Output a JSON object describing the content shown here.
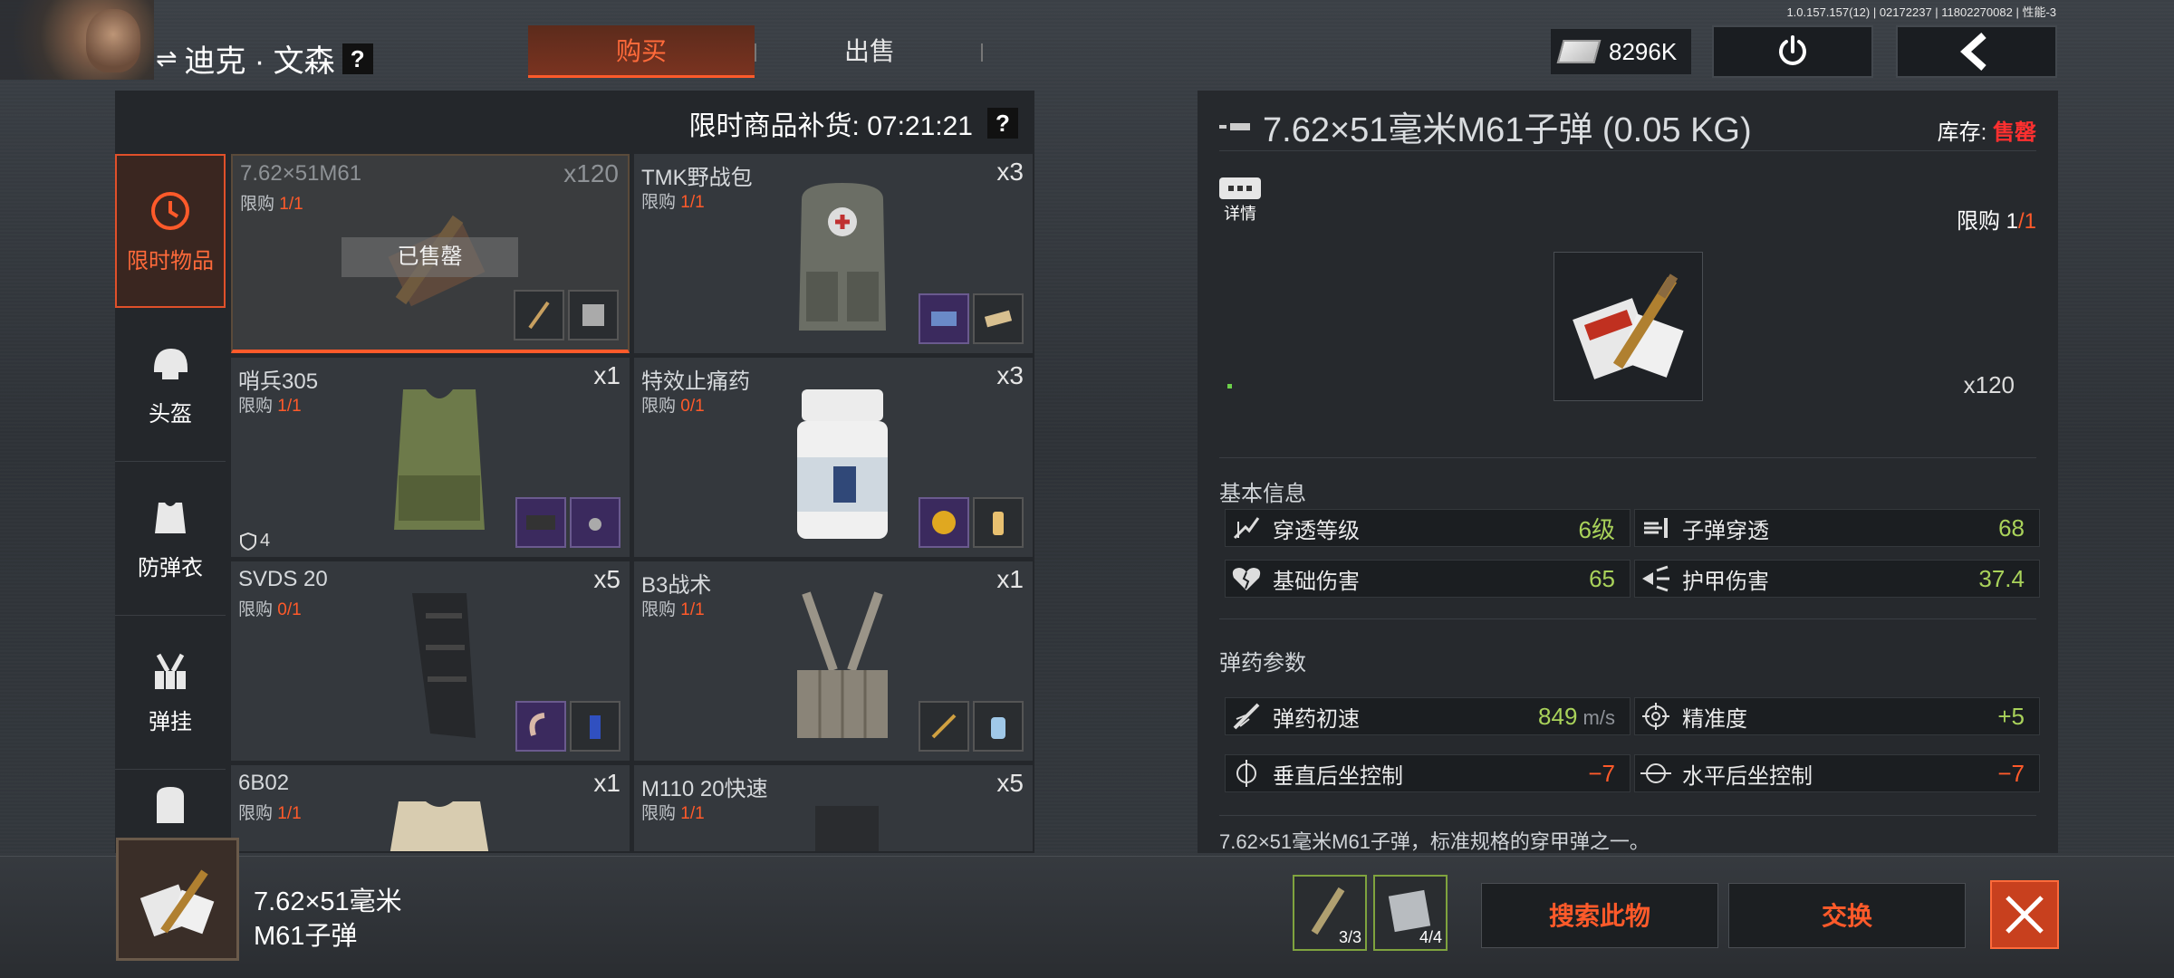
{
  "version": "1.0.157.157(12) | 02172237 | 11802270082 | 性能-3",
  "header": {
    "character_name": "迪克 · 文森",
    "help": "?",
    "tabs": [
      {
        "label": "购买",
        "active": true
      },
      {
        "label": "出售",
        "active": false
      }
    ],
    "money": "8296K"
  },
  "shop": {
    "restock_label": "限时商品补货: 07:21:21",
    "help": "?",
    "categories": [
      {
        "label": "限时物品",
        "icon": "clock-icon",
        "active": true
      },
      {
        "label": "头盔",
        "icon": "helmet-icon",
        "active": false
      },
      {
        "label": "防弹衣",
        "icon": "vest-icon",
        "active": false
      },
      {
        "label": "弹挂",
        "icon": "chest-rig-icon",
        "active": false
      }
    ],
    "items": [
      {
        "name": "7.62×51M61",
        "limit_label": "限购",
        "limit": "1/1",
        "qty": "x120",
        "status": "已售罄"
      },
      {
        "name": "TMK野战包",
        "limit_label": "限购",
        "limit": "1/1",
        "qty": "x3"
      },
      {
        "name": "哨兵305",
        "limit_label": "限购",
        "limit": "1/1",
        "qty": "x1",
        "armor": "4"
      },
      {
        "name": "特效止痛药",
        "limit_label": "限购",
        "limit": "0/1",
        "qty": "x3"
      },
      {
        "name": "SVDS 20",
        "limit_label": "限购",
        "limit": "0/1",
        "qty": "x5"
      },
      {
        "name": "B3战术",
        "limit_label": "限购",
        "limit": "1/1",
        "qty": "x1"
      },
      {
        "name": "6B02",
        "limit_label": "限购",
        "limit": "1/1",
        "qty": "x1"
      },
      {
        "name": "M110 20快速",
        "limit_label": "限购",
        "limit": "1/1",
        "qty": "x5"
      }
    ]
  },
  "detail": {
    "title": "7.62×51毫米M61子弹 (0.05 KG)",
    "stock_label": "库存: ",
    "stock_value": "售罄",
    "detail_label": "详情",
    "limit_label": "限购 ",
    "limit_used": "1",
    "limit_total": "/1",
    "quantity": "x120",
    "basic_title": "基本信息",
    "basic_stats": [
      {
        "label": "穿透等级",
        "value": "6级",
        "icon": "penetration-icon"
      },
      {
        "label": "子弹穿透",
        "value": "68",
        "icon": "bullet-pen-icon"
      },
      {
        "label": "基础伤害",
        "value": "65",
        "icon": "broken-heart-icon"
      },
      {
        "label": "护甲伤害",
        "value": "37.4",
        "icon": "armor-damage-icon"
      }
    ],
    "ammo_title": "弹药参数",
    "ammo_stats": [
      {
        "label": "弹药初速",
        "value": "849",
        "unit": " m/s",
        "icon": "velocity-icon"
      },
      {
        "label": "精准度",
        "value": "+5",
        "icon": "crosshair-icon"
      },
      {
        "label": "垂直后坐控制",
        "value": "−7",
        "icon": "vertical-recoil-icon"
      },
      {
        "label": "水平后坐控制",
        "value": "−7",
        "icon": "horizontal-recoil-icon"
      }
    ],
    "description": "7.62×51毫米M61子弹，标准规格的穿甲弹之一。"
  },
  "footer": {
    "selected_name_line1": "7.62×51毫米",
    "selected_name_line2": "M61子弹",
    "slots": [
      {
        "count": "3/3"
      },
      {
        "count": "4/4"
      }
    ],
    "search_button": "搜索此物",
    "exchange_button": "交换"
  },
  "colors": {
    "accent": "#ff5a2a",
    "positive": "#a9d25a",
    "soldout": "#ff3030"
  }
}
